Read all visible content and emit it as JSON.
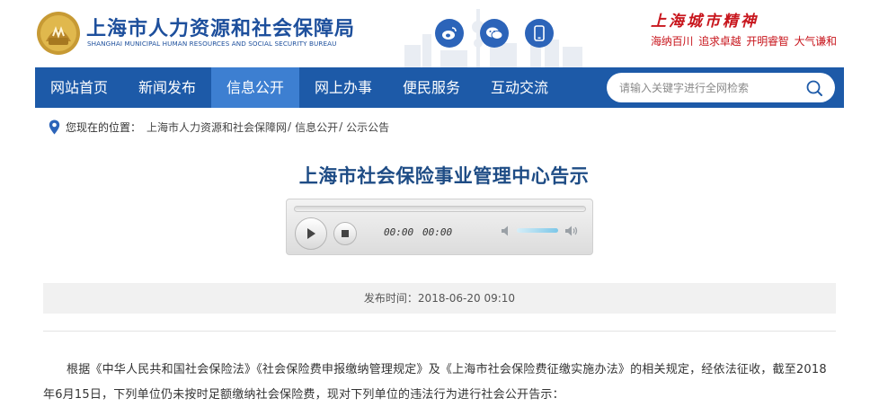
{
  "header": {
    "site_name_cn": "上海市人力资源和社会保障局",
    "site_name_en": "SHANGHAI MUNICIPAL HUMAN RESOURCES AND SOCIAL SECURITY BUREAU",
    "logo_icon": "shanghai-emblem-icon",
    "social": [
      {
        "name": "weibo-icon"
      },
      {
        "name": "wechat-icon"
      },
      {
        "name": "mobile-icon"
      }
    ],
    "spirit_title": "上海城市精神",
    "spirit_motto": [
      "海纳百川",
      "追求卓越",
      "开明睿智",
      "大气谦和"
    ]
  },
  "nav": {
    "items": [
      {
        "label": "网站首页"
      },
      {
        "label": "新闻发布"
      },
      {
        "label": "信息公开",
        "active": true
      },
      {
        "label": "网上办事"
      },
      {
        "label": "便民服务"
      },
      {
        "label": "互动交流"
      }
    ],
    "search_placeholder": "请输入关键字进行全网检索"
  },
  "breadcrumb": {
    "prefix": "您现在的位置：",
    "items": [
      "上海市人力资源和社会保障网",
      "信息公开",
      "公示公告"
    ],
    "separator": "/"
  },
  "article": {
    "title": "上海市社会保险事业管理中心告示",
    "player": {
      "current_time": "00:00",
      "duration": "00:00"
    },
    "publish_time": "发布时间：2018-06-20 09:10",
    "body": "根据《中华人民共和国社会保险法》《社会保险费申报缴纳管理规定》及《上海市社会保险费征缴实施办法》的相关规定，经依法征收，截至2018年6月15日，下列单位仍未按时足额缴纳社会保险费，现对下列单位的违法行为进行社会公开告示："
  },
  "colors": {
    "nav_bg": "#1d5aa8",
    "nav_active": "#3d7fd1",
    "title_blue": "#1e4c85",
    "brand_red": "#c8161d"
  }
}
